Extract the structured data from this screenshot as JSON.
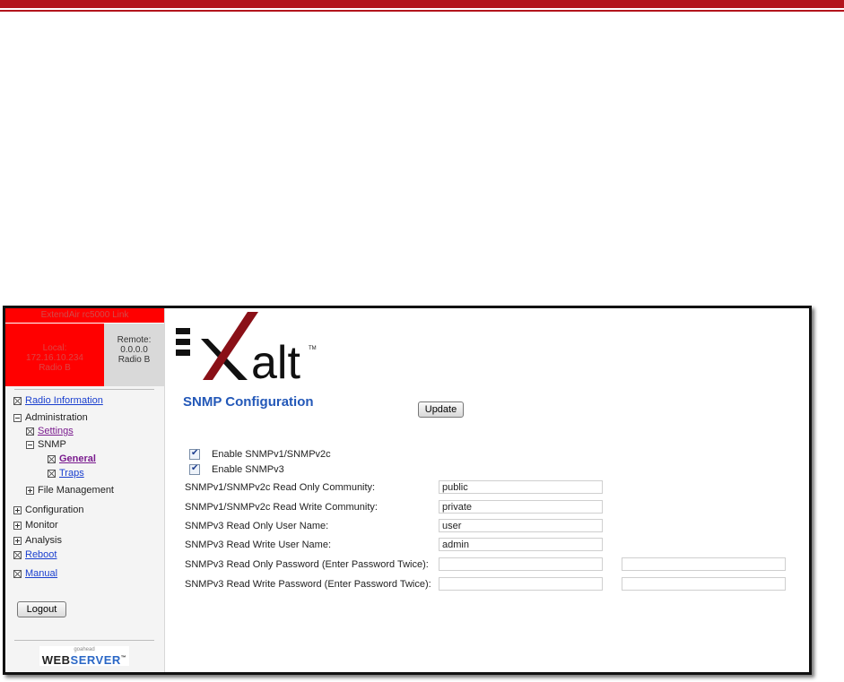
{
  "sidebar": {
    "link_name": "ExtendAir rc5000 Link",
    "local": {
      "label": "Local:",
      "ip": "172.16.10.234",
      "radio": "Radio B"
    },
    "remote": {
      "label": "Remote:",
      "ip": "0.0.0.0",
      "radio": "Radio B"
    },
    "nav": {
      "radio_information": "Radio Information",
      "administration": "Administration",
      "settings": "Settings",
      "snmp": "SNMP",
      "general": "General",
      "traps": "Traps",
      "file_management": "File Management",
      "configuration": "Configuration",
      "monitor": "Monitor",
      "analysis": "Analysis",
      "reboot": "Reboot",
      "manual": "Manual"
    },
    "logout_label": "Logout",
    "webserver": {
      "small": "goahead",
      "web": "WEB",
      "server": "SERVER",
      "tm": "™"
    }
  },
  "brand": {
    "logo_text": "alt",
    "tm": "TM"
  },
  "main": {
    "title": "SNMP Configuration",
    "update_label": "Update",
    "checkboxes": [
      {
        "label": "Enable SNMPv1/SNMPv2c",
        "checked": true
      },
      {
        "label": "Enable SNMPv3",
        "checked": true
      }
    ],
    "fields": [
      {
        "label": "SNMPv1/SNMPv2c Read Only Community:",
        "value": "public"
      },
      {
        "label": "SNMPv1/SNMPv2c Read Write Community:",
        "value": "private"
      },
      {
        "label": "SNMPv3 Read Only User Name:",
        "value": "user"
      },
      {
        "label": "SNMPv3 Read Write User Name:",
        "value": "admin"
      },
      {
        "label": "SNMPv3 Read Only Password (Enter Password Twice):",
        "value": "",
        "confirm": ""
      },
      {
        "label": "SNMPv3 Read Write Password (Enter Password Twice):",
        "value": "",
        "confirm": ""
      }
    ]
  },
  "colors": {
    "accent_red": "#b3141c",
    "status_red": "#ff0000",
    "title_blue": "#2358b8",
    "link_blue": "#1a3fcf"
  }
}
